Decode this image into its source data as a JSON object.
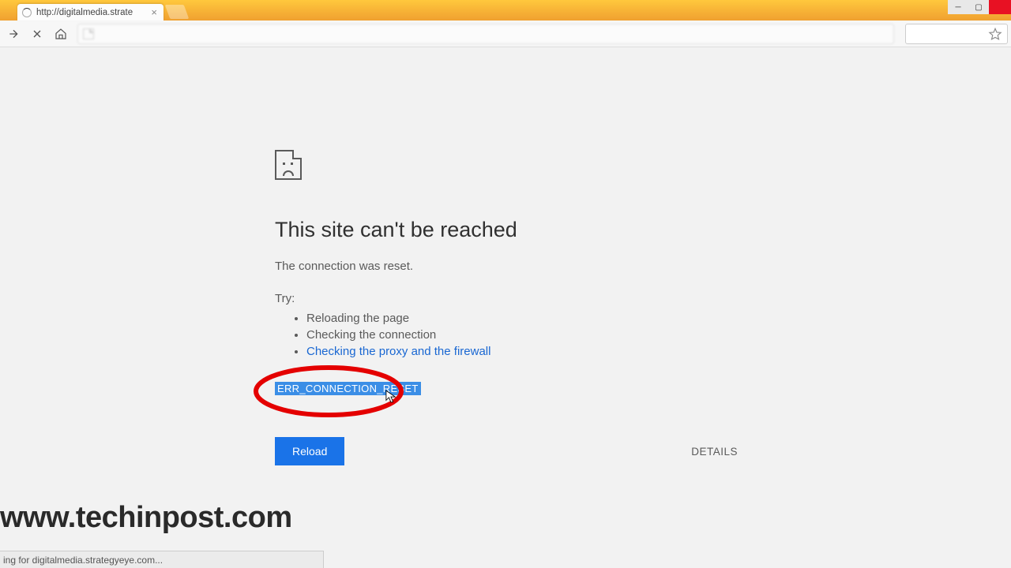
{
  "tab": {
    "title": "http://digitalmedia.strate"
  },
  "error": {
    "heading": "This site can't be reached",
    "subtitle": "The connection was reset.",
    "try_label": "Try:",
    "suggestions": [
      "Reloading the page",
      "Checking the connection",
      "Checking the proxy and the firewall"
    ],
    "code": "ERR_CONNECTION_RESET",
    "reload_label": "Reload",
    "details_label": "DETAILS"
  },
  "status_text": "ing for digitalmedia.strategyeye.com...",
  "watermark": "www.techinpost.com"
}
